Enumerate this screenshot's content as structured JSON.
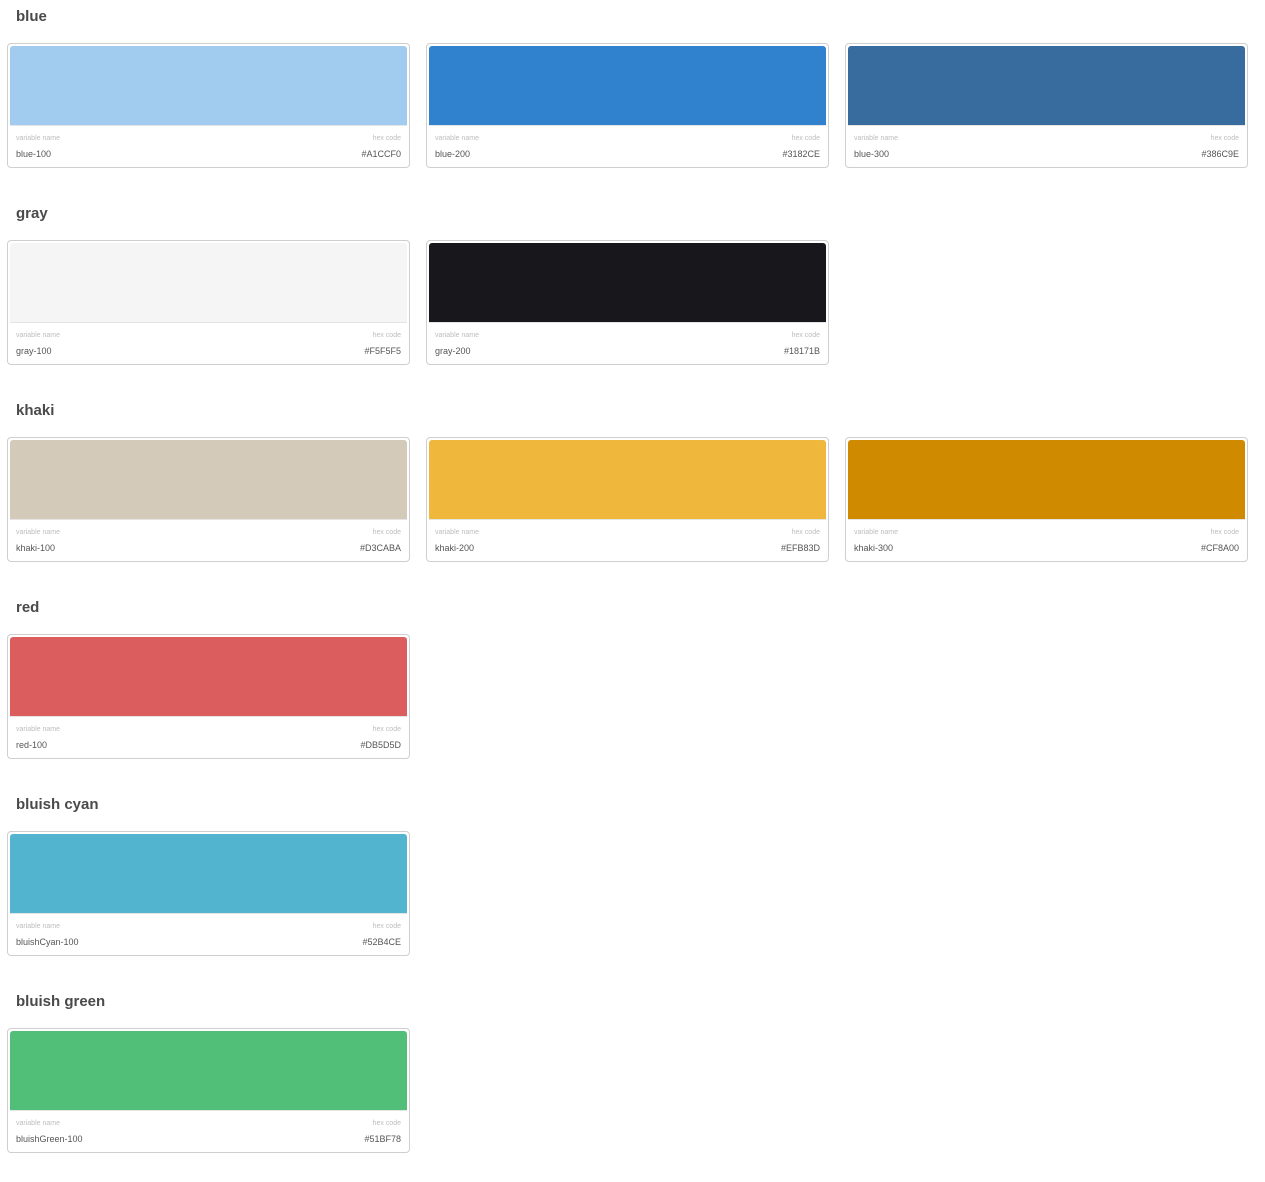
{
  "labels": {
    "variable_name": "variable name",
    "hex_code": "hex code"
  },
  "groups": [
    {
      "title": "blue",
      "swatches": [
        {
          "name": "blue-100",
          "hex": "#A1CCF0"
        },
        {
          "name": "blue-200",
          "hex": "#3182CE"
        },
        {
          "name": "blue-300",
          "hex": "#386C9E"
        }
      ]
    },
    {
      "title": "gray",
      "swatches": [
        {
          "name": "gray-100",
          "hex": "#F5F5F5"
        },
        {
          "name": "gray-200",
          "hex": "#18171B"
        }
      ]
    },
    {
      "title": "khaki",
      "swatches": [
        {
          "name": "khaki-100",
          "hex": "#D3CABA"
        },
        {
          "name": "khaki-200",
          "hex": "#EFB83D"
        },
        {
          "name": "khaki-300",
          "hex": "#CF8A00"
        }
      ]
    },
    {
      "title": "red",
      "swatches": [
        {
          "name": "red-100",
          "hex": "#DB5D5D"
        }
      ]
    },
    {
      "title": "bluish cyan",
      "swatches": [
        {
          "name": "bluishCyan-100",
          "hex": "#52B4CE"
        }
      ]
    },
    {
      "title": "bluish green",
      "swatches": [
        {
          "name": "bluishGreen-100",
          "hex": "#51BF78"
        }
      ]
    }
  ]
}
